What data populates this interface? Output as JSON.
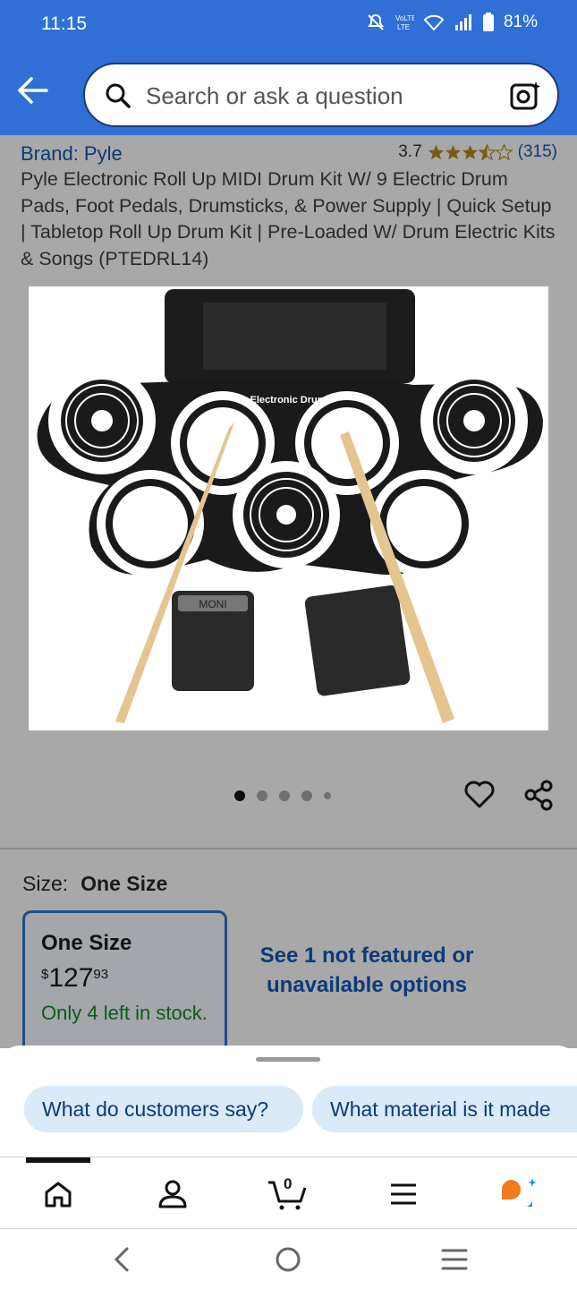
{
  "status_bar": {
    "time": "11:15",
    "battery": "81%",
    "icons": [
      "mute-icon",
      "volte-icon",
      "wifi-icon",
      "signal-icon",
      "battery-icon"
    ]
  },
  "header": {
    "back_icon": "back-arrow-icon",
    "search_placeholder": "Search or ask a question",
    "search_icon": "search-icon",
    "camera_icon": "camera-lens-icon",
    "accent_color": "#2f6fd6"
  },
  "product": {
    "brand": "Brand: Pyle",
    "rating_value": "3.7",
    "rating_stars": 3.7,
    "rating_count": "(315)",
    "title": "Pyle Electronic Roll Up MIDI Drum Kit W/ 9 Electric Drum Pads, Foot Pedals, Drumsticks, & Power Supply | Quick Setup | Tabletop Roll Up Drum Kit | Pre-Loaded W/ Drum Electric Kits & Songs (PTEDRL14)",
    "image_label": "Electronic Drum",
    "pedal_label": "MONI",
    "carousel_dots": 5,
    "carousel_active": 0
  },
  "size": {
    "label": "Size:",
    "value": "One Size",
    "card": {
      "name": "One Size",
      "price_currency": "$",
      "price_whole": "127",
      "price_fraction": "93",
      "stock": "Only 4 left in stock."
    },
    "see_more": "See 1 not featured or unavailable options"
  },
  "sheet": {
    "chips": [
      "What do customers say?",
      "What material is it made"
    ]
  },
  "bottom_nav": {
    "items": [
      "home-icon",
      "account-icon",
      "cart-icon",
      "menu-icon",
      "rufus-icon"
    ],
    "cart_count": "0"
  },
  "system_nav": [
    "recent-apps-icon",
    "home-circle-icon",
    "back-chevron-icon"
  ]
}
